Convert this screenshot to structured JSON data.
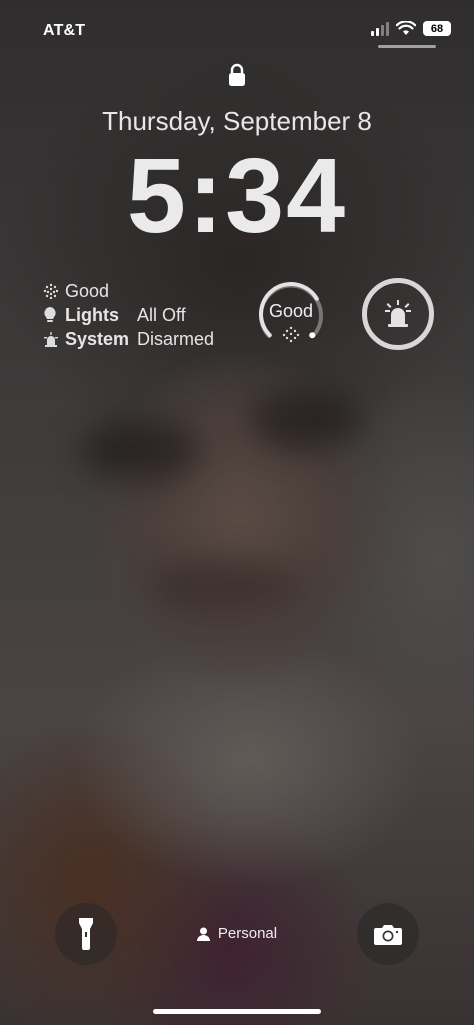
{
  "status_bar": {
    "carrier": "AT&T",
    "battery": "68",
    "signal_icon": "cellular-signal-icon",
    "wifi_icon": "wifi-icon"
  },
  "lock_icon": "lock-icon",
  "date": "Thursday, September 8",
  "time": "5:34",
  "home_widget": {
    "air_quality": "Good",
    "lights_label": "Lights",
    "lights_value": "All Off",
    "system_label": "System",
    "system_value": "Disarmed"
  },
  "air_ring": {
    "label": "Good",
    "level": 0.72
  },
  "alarm_widget": {
    "icon": "alarm-siren-icon"
  },
  "bottom": {
    "flashlight_icon": "flashlight-icon",
    "focus_label": "Personal",
    "focus_icon": "person-icon",
    "camera_icon": "camera-icon"
  }
}
